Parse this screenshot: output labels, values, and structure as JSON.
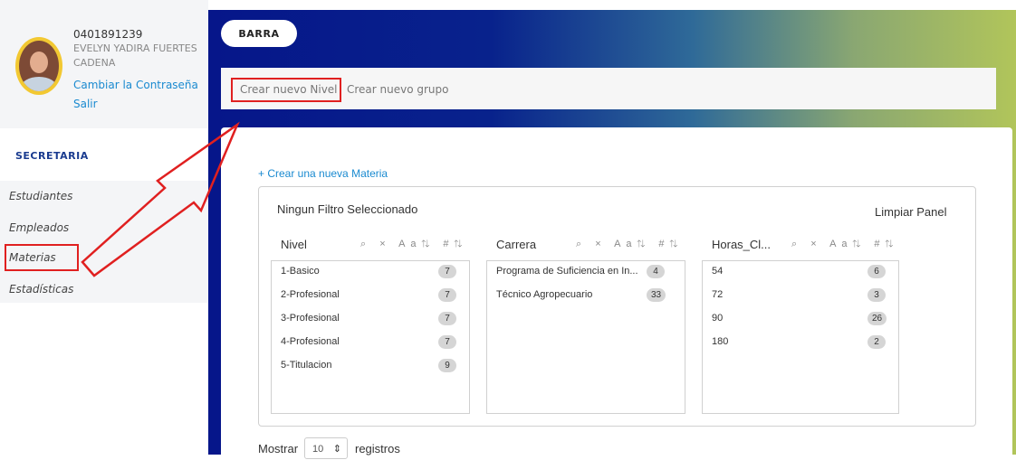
{
  "user": {
    "id": "0401891239",
    "name": "EVELYN YADIRA FUERTES CADENA",
    "change_password": "Cambiar la Contraseña",
    "logout": "Salir"
  },
  "sidebar": {
    "section_title": "SECRETARIA",
    "items": [
      {
        "label": "Estudiantes"
      },
      {
        "label": "Empleados"
      },
      {
        "label": "Materias"
      },
      {
        "label": "Estadísticas"
      }
    ]
  },
  "header": {
    "barra_label": "BARRA"
  },
  "menu": {
    "create_level": "Crear nuevo Nivel",
    "create_group": "Crear nuevo grupo"
  },
  "content": {
    "new_materia": "+ Crear una nueva Materia",
    "filter_status": "Ningun Filtro Seleccionado",
    "clear_panel": "Limpiar Panel",
    "columns": [
      {
        "header": "Nivel",
        "rows": [
          {
            "label": "1-Basico",
            "count": "7"
          },
          {
            "label": "2-Profesional",
            "count": "7"
          },
          {
            "label": "3-Profesional",
            "count": "7"
          },
          {
            "label": "4-Profesional",
            "count": "7"
          },
          {
            "label": "5-Titulacion",
            "count": "9"
          }
        ]
      },
      {
        "header": "Carrera",
        "rows": [
          {
            "label": "Programa de Suficiencia en In...",
            "count": "4"
          },
          {
            "label": "Técnico Agropecuario",
            "count": "33"
          }
        ]
      },
      {
        "header": "Horas_Cl...",
        "rows": [
          {
            "label": "54",
            "count": "6"
          },
          {
            "label": "72",
            "count": "3"
          },
          {
            "label": "90",
            "count": "26"
          },
          {
            "label": "180",
            "count": "2"
          }
        ]
      }
    ],
    "icons": [
      "search-icon",
      "clear-icon",
      "sort-alpha-icon",
      "sort-count-icon"
    ],
    "header_icons_text": "⌕ × Aa⇅ #⇅",
    "show_label": "Mostrar",
    "show_value": "10",
    "records_label": "registros"
  },
  "colors": {
    "link": "#1a8ad0",
    "highlight": "#e02020",
    "section": "#1a3b8f"
  }
}
